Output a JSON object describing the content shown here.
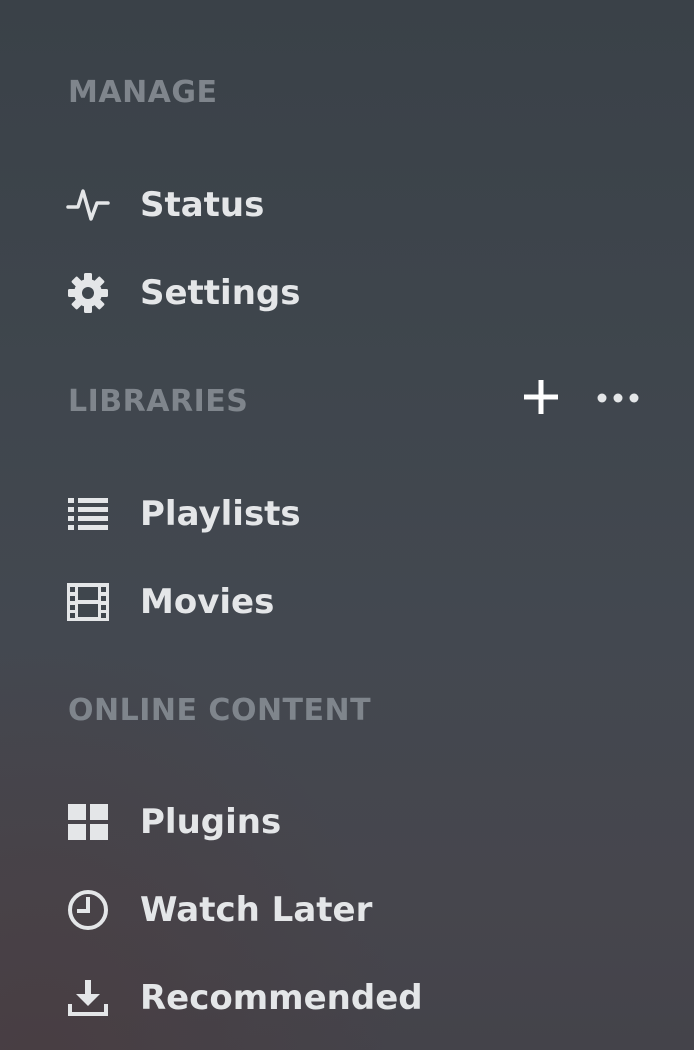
{
  "sections": {
    "manage": {
      "title": "MANAGE",
      "items": [
        {
          "label": "Status",
          "icon": "activity-icon"
        },
        {
          "label": "Settings",
          "icon": "gear-icon"
        }
      ]
    },
    "libraries": {
      "title": "LIBRARIES",
      "actions": [
        {
          "icon": "plus-icon"
        },
        {
          "icon": "more-icon"
        }
      ],
      "items": [
        {
          "label": "Playlists",
          "icon": "list-icon"
        },
        {
          "label": "Movies",
          "icon": "film-icon"
        }
      ]
    },
    "online_content": {
      "title": "ONLINE CONTENT",
      "items": [
        {
          "label": "Plugins",
          "icon": "grid-icon"
        },
        {
          "label": "Watch Later",
          "icon": "clock-icon"
        },
        {
          "label": "Recommended",
          "icon": "download-icon"
        }
      ]
    }
  },
  "colors": {
    "header_text": "#7f858c",
    "item_text": "#e4e6e8",
    "icon": "#e4e6e8"
  }
}
